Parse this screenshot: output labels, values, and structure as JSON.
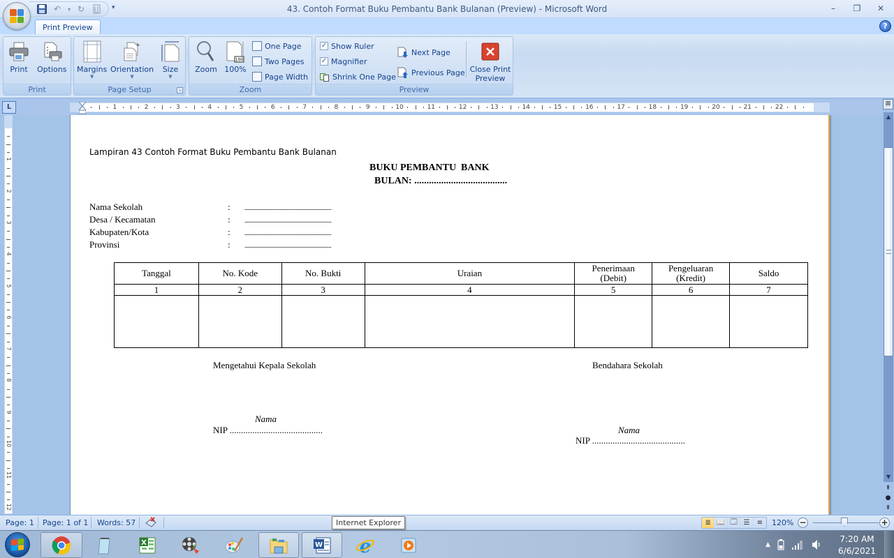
{
  "window": {
    "title": "43. Contoh Format Buku Pembantu Bank Bulanan (Preview) - Microsoft Word",
    "controls": {
      "minimize": "–",
      "restore": "❐",
      "close": "✕"
    }
  },
  "quick_access": {
    "items": [
      {
        "name": "save",
        "icon": "floppy-disk-icon",
        "glyph": "💾"
      },
      {
        "name": "undo",
        "icon": "undo-icon",
        "glyph": "↶"
      },
      {
        "name": "undo-dropdown",
        "icon": "chevron-down-icon",
        "glyph": "▾"
      },
      {
        "name": "redo",
        "icon": "redo-icon",
        "glyph": "↻"
      },
      {
        "name": "attach",
        "icon": "attach-icon",
        "glyph": "📎"
      }
    ],
    "customize": "▾"
  },
  "ribbon": {
    "active_tab": "Print Preview",
    "help": "?",
    "groups": {
      "print": {
        "label": "Print",
        "buttons": [
          {
            "label": "Print",
            "icon": "printer-icon"
          },
          {
            "label": "Options",
            "icon": "print-options-icon"
          }
        ]
      },
      "page_setup": {
        "label": "Page Setup",
        "buttons": [
          {
            "label": "Margins",
            "icon": "margins-icon"
          },
          {
            "label": "Orientation",
            "icon": "orientation-icon"
          },
          {
            "label": "Size",
            "icon": "page-size-icon"
          }
        ],
        "launcher": "↘"
      },
      "zoom": {
        "label": "Zoom",
        "buttons": [
          {
            "label": "Zoom",
            "icon": "magnifier-icon"
          },
          {
            "label": "100%",
            "icon": "hundred-percent-icon",
            "badge": "100"
          }
        ],
        "small": [
          {
            "label": "One Page",
            "icon": "one-page-icon"
          },
          {
            "label": "Two Pages",
            "icon": "two-pages-icon"
          },
          {
            "label": "Page Width",
            "icon": "page-width-icon"
          }
        ]
      },
      "preview": {
        "label": "Preview",
        "checks": [
          {
            "label": "Show Ruler",
            "checked": true
          },
          {
            "label": "Magnifier",
            "checked": true
          }
        ],
        "shrink": "Shrink One Page",
        "next": "Next Page",
        "previous": "Previous Page",
        "close": "Close Print Preview",
        "close_line1": "Close Print",
        "close_line2": "Preview"
      }
    }
  },
  "ruler": {
    "tab_selector": "L",
    "h_numbers": [
      "1",
      "2",
      "3",
      "4",
      "5",
      "6",
      "7",
      "8",
      "9",
      "10",
      "11",
      "12",
      "13",
      "14",
      "15",
      "16",
      "17",
      "18",
      "19",
      "20",
      "21",
      "22"
    ],
    "v_numbers": [
      "1",
      "2",
      "3",
      "4",
      "5",
      "6",
      "7",
      "8",
      "9",
      "10",
      "11",
      "12"
    ]
  },
  "document": {
    "lampiran": "Lampiran 43 Contoh  Format Buku Pembantu  Bank Bulanan",
    "title": "BUKU PEMBANTU  BANK",
    "bulan": "BULAN: ......................................",
    "info": [
      {
        "label": "Nama Sekolah",
        "colon": ":",
        "value": "......................................................................."
      },
      {
        "label": "Desa / Kecamatan",
        "colon": ":",
        "value": "......................................................................."
      },
      {
        "label": "Kabupaten/Kota",
        "colon": ":",
        "value": "......................................................................."
      },
      {
        "label": "Provinsi",
        "colon": ":",
        "value": "......................................................................."
      }
    ],
    "table": {
      "headers": [
        {
          "line1": "Tanggal",
          "line2": ""
        },
        {
          "line1": "No. Kode",
          "line2": ""
        },
        {
          "line1": "No. Bukti",
          "line2": ""
        },
        {
          "line1": "Uraian",
          "line2": ""
        },
        {
          "line1": "Penerimaan",
          "line2": "(Debit)"
        },
        {
          "line1": "Pengeluaran",
          "line2": "(Kredit)"
        },
        {
          "line1": "Saldo",
          "line2": ""
        }
      ],
      "numbers": [
        "1",
        "2",
        "3",
        "4",
        "5",
        "6",
        "7"
      ],
      "rows": [
        [
          "",
          "",
          "",
          "",
          "",
          "",
          ""
        ]
      ]
    },
    "signatures": {
      "left": {
        "title": "Mengetahui Kepala Sekolah",
        "name": "Nama",
        "nip": "NIP ........................................."
      },
      "right": {
        "title": "Bendahara Sekolah",
        "name": "Nama",
        "nip": "NIP ........................................."
      }
    }
  },
  "statusbar": {
    "page": "Page: 1",
    "page_of": "Page: 1 of 1",
    "words": "Words: 57",
    "proofing_icon": "proofing-error-icon",
    "views": [
      "Print Layout",
      "Full Screen Reading",
      "Web Layout",
      "Outline",
      "Draft"
    ],
    "active_view": "Print Layout",
    "zoom": "120%",
    "zoom_percent": 120,
    "zoom_minus": "−",
    "zoom_plus": "+"
  },
  "tooltip": "Internet Explorer",
  "taskbar": {
    "apps": [
      {
        "name": "Google Chrome",
        "icon": "chrome-icon",
        "open": true
      },
      {
        "name": "Notepad",
        "icon": "notepad-icon",
        "open": false
      },
      {
        "name": "Microsoft Excel",
        "icon": "excel-icon",
        "open": false
      },
      {
        "name": "Windows Movie Maker",
        "icon": "movie-maker-icon",
        "open": false
      },
      {
        "name": "Paint",
        "icon": "paint-icon",
        "open": false
      },
      {
        "name": "Windows Explorer",
        "icon": "folder-icon",
        "open": true
      },
      {
        "name": "Microsoft Word",
        "icon": "word-icon",
        "open": true
      },
      {
        "name": "Internet Explorer",
        "icon": "internet-explorer-icon",
        "open": false
      },
      {
        "name": "Windows Media Player",
        "icon": "media-player-icon",
        "open": false
      }
    ],
    "tray": {
      "show_hidden": "▲",
      "battery": "battery-icon",
      "signal": "signal-icon",
      "volume": "volume-icon"
    },
    "clock": {
      "time": "7:20 AM",
      "date": "6/6/2021"
    }
  }
}
